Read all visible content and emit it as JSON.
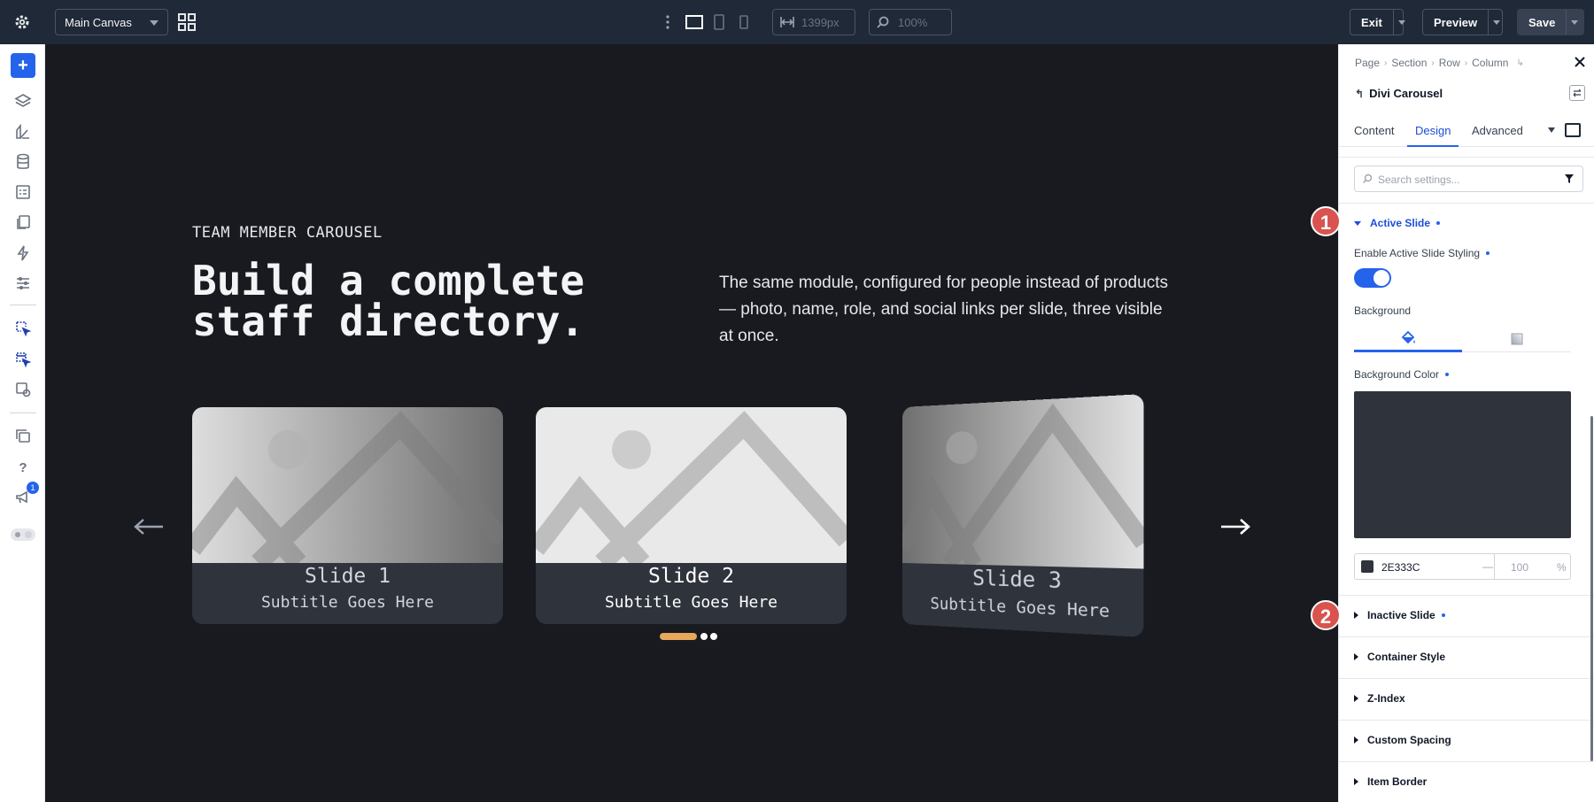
{
  "topbar": {
    "canvas_select": "Main Canvas",
    "width_value": "1399px",
    "zoom_value": "100%",
    "exit_label": "Exit",
    "preview_label": "Preview",
    "save_label": "Save"
  },
  "leftbar": {
    "notification_count": "1"
  },
  "canvas": {
    "eyebrow": "TEAM MEMBER CAROUSEL",
    "headline_line1": "Build a complete",
    "headline_line2": "staff directory.",
    "intro": "The same module, configured for people instead of products — photo, name, role, and social links per slide, three visible at once.",
    "slides": [
      {
        "title": "Slide 1",
        "subtitle": "Subtitle Goes Here"
      },
      {
        "title": "Slide 2",
        "subtitle": "Subtitle Goes Here"
      },
      {
        "title": "Slide 3",
        "subtitle": "Subtitle Goes Here"
      }
    ],
    "accent_color": "#E5A85C"
  },
  "panel": {
    "breadcrumb": [
      "Page",
      "Section",
      "Row",
      "Column"
    ],
    "module_name": "Divi Carousel",
    "tabs": [
      "Content",
      "Design",
      "Advanced"
    ],
    "active_tab": "Design",
    "search_placeholder": "Search settings...",
    "active_slide_section": "Active Slide",
    "enable_label": "Enable Active Slide Styling",
    "enable_value": true,
    "background_label": "Background",
    "background_color_label": "Background Color",
    "color_hex": "2E333C",
    "opacity_placeholder": "100",
    "opacity_unit": "%",
    "sections": [
      "Inactive Slide",
      "Container Style",
      "Z-Index",
      "Custom Spacing",
      "Item Border"
    ],
    "brand_color": "#2563EB"
  },
  "callouts": [
    "1",
    "2"
  ]
}
